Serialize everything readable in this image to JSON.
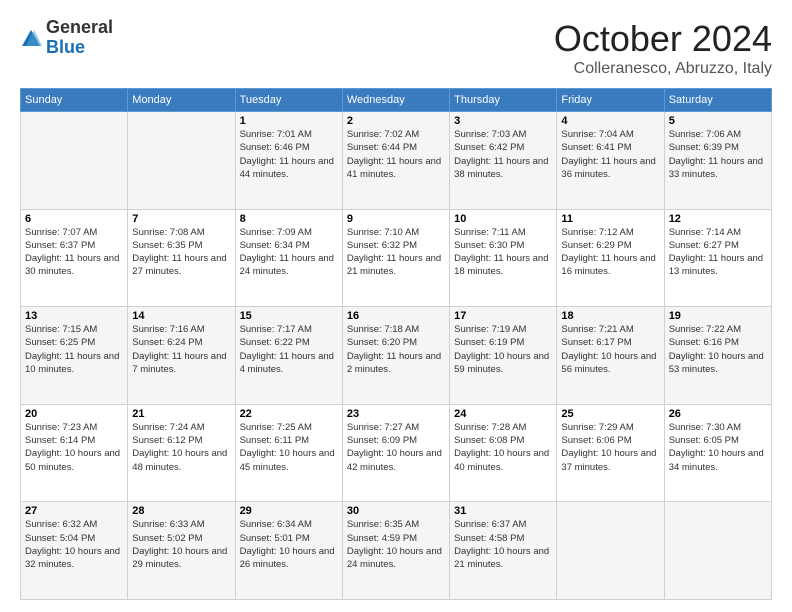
{
  "header": {
    "logo_general": "General",
    "logo_blue": "Blue",
    "month_title": "October 2024",
    "location": "Colleranesco, Abruzzo, Italy"
  },
  "weekdays": [
    "Sunday",
    "Monday",
    "Tuesday",
    "Wednesday",
    "Thursday",
    "Friday",
    "Saturday"
  ],
  "weeks": [
    [
      {
        "day": "",
        "info": ""
      },
      {
        "day": "",
        "info": ""
      },
      {
        "day": "1",
        "info": "Sunrise: 7:01 AM\nSunset: 6:46 PM\nDaylight: 11 hours and 44 minutes."
      },
      {
        "day": "2",
        "info": "Sunrise: 7:02 AM\nSunset: 6:44 PM\nDaylight: 11 hours and 41 minutes."
      },
      {
        "day": "3",
        "info": "Sunrise: 7:03 AM\nSunset: 6:42 PM\nDaylight: 11 hours and 38 minutes."
      },
      {
        "day": "4",
        "info": "Sunrise: 7:04 AM\nSunset: 6:41 PM\nDaylight: 11 hours and 36 minutes."
      },
      {
        "day": "5",
        "info": "Sunrise: 7:06 AM\nSunset: 6:39 PM\nDaylight: 11 hours and 33 minutes."
      }
    ],
    [
      {
        "day": "6",
        "info": "Sunrise: 7:07 AM\nSunset: 6:37 PM\nDaylight: 11 hours and 30 minutes."
      },
      {
        "day": "7",
        "info": "Sunrise: 7:08 AM\nSunset: 6:35 PM\nDaylight: 11 hours and 27 minutes."
      },
      {
        "day": "8",
        "info": "Sunrise: 7:09 AM\nSunset: 6:34 PM\nDaylight: 11 hours and 24 minutes."
      },
      {
        "day": "9",
        "info": "Sunrise: 7:10 AM\nSunset: 6:32 PM\nDaylight: 11 hours and 21 minutes."
      },
      {
        "day": "10",
        "info": "Sunrise: 7:11 AM\nSunset: 6:30 PM\nDaylight: 11 hours and 18 minutes."
      },
      {
        "day": "11",
        "info": "Sunrise: 7:12 AM\nSunset: 6:29 PM\nDaylight: 11 hours and 16 minutes."
      },
      {
        "day": "12",
        "info": "Sunrise: 7:14 AM\nSunset: 6:27 PM\nDaylight: 11 hours and 13 minutes."
      }
    ],
    [
      {
        "day": "13",
        "info": "Sunrise: 7:15 AM\nSunset: 6:25 PM\nDaylight: 11 hours and 10 minutes."
      },
      {
        "day": "14",
        "info": "Sunrise: 7:16 AM\nSunset: 6:24 PM\nDaylight: 11 hours and 7 minutes."
      },
      {
        "day": "15",
        "info": "Sunrise: 7:17 AM\nSunset: 6:22 PM\nDaylight: 11 hours and 4 minutes."
      },
      {
        "day": "16",
        "info": "Sunrise: 7:18 AM\nSunset: 6:20 PM\nDaylight: 11 hours and 2 minutes."
      },
      {
        "day": "17",
        "info": "Sunrise: 7:19 AM\nSunset: 6:19 PM\nDaylight: 10 hours and 59 minutes."
      },
      {
        "day": "18",
        "info": "Sunrise: 7:21 AM\nSunset: 6:17 PM\nDaylight: 10 hours and 56 minutes."
      },
      {
        "day": "19",
        "info": "Sunrise: 7:22 AM\nSunset: 6:16 PM\nDaylight: 10 hours and 53 minutes."
      }
    ],
    [
      {
        "day": "20",
        "info": "Sunrise: 7:23 AM\nSunset: 6:14 PM\nDaylight: 10 hours and 50 minutes."
      },
      {
        "day": "21",
        "info": "Sunrise: 7:24 AM\nSunset: 6:12 PM\nDaylight: 10 hours and 48 minutes."
      },
      {
        "day": "22",
        "info": "Sunrise: 7:25 AM\nSunset: 6:11 PM\nDaylight: 10 hours and 45 minutes."
      },
      {
        "day": "23",
        "info": "Sunrise: 7:27 AM\nSunset: 6:09 PM\nDaylight: 10 hours and 42 minutes."
      },
      {
        "day": "24",
        "info": "Sunrise: 7:28 AM\nSunset: 6:08 PM\nDaylight: 10 hours and 40 minutes."
      },
      {
        "day": "25",
        "info": "Sunrise: 7:29 AM\nSunset: 6:06 PM\nDaylight: 10 hours and 37 minutes."
      },
      {
        "day": "26",
        "info": "Sunrise: 7:30 AM\nSunset: 6:05 PM\nDaylight: 10 hours and 34 minutes."
      }
    ],
    [
      {
        "day": "27",
        "info": "Sunrise: 6:32 AM\nSunset: 5:04 PM\nDaylight: 10 hours and 32 minutes."
      },
      {
        "day": "28",
        "info": "Sunrise: 6:33 AM\nSunset: 5:02 PM\nDaylight: 10 hours and 29 minutes."
      },
      {
        "day": "29",
        "info": "Sunrise: 6:34 AM\nSunset: 5:01 PM\nDaylight: 10 hours and 26 minutes."
      },
      {
        "day": "30",
        "info": "Sunrise: 6:35 AM\nSunset: 4:59 PM\nDaylight: 10 hours and 24 minutes."
      },
      {
        "day": "31",
        "info": "Sunrise: 6:37 AM\nSunset: 4:58 PM\nDaylight: 10 hours and 21 minutes."
      },
      {
        "day": "",
        "info": ""
      },
      {
        "day": "",
        "info": ""
      }
    ]
  ]
}
